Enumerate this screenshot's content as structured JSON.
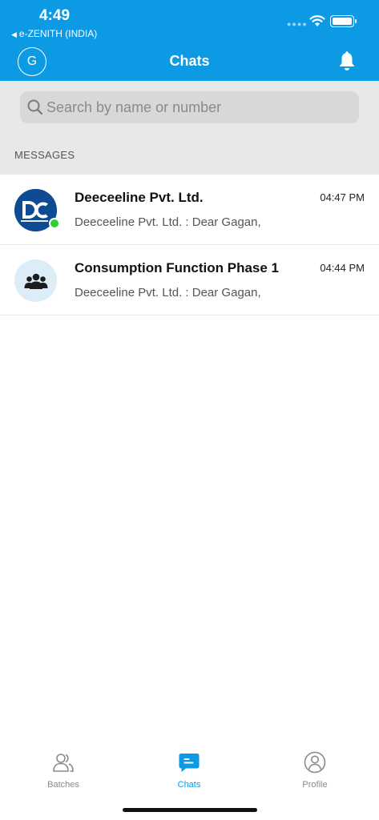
{
  "status_bar": {
    "time": "4:49",
    "back_app": "e-ZENITH (INDIA)",
    "back_icon": "back-triangle-icon"
  },
  "header": {
    "avatar_initial": "G",
    "title": "Chats",
    "bell_icon": "bell-icon"
  },
  "search": {
    "placeholder": "Search by name or number",
    "value": ""
  },
  "section": {
    "label": "MESSAGES"
  },
  "chats": [
    {
      "name": "Deeceeline Pvt. Ltd.",
      "time": "04:47 PM",
      "preview": "Deeceeline Pvt. Ltd. : Dear Gagan,",
      "avatar_text": "DC",
      "online": true
    },
    {
      "name": "Consumption Function Phase 1",
      "time": "04:44 PM",
      "preview": "Deeceeline Pvt. Ltd. : Dear Gagan,",
      "avatar_icon": "group-icon",
      "online": false
    }
  ],
  "tabs": [
    {
      "label": "Batches",
      "icon": "batches-icon",
      "active": false
    },
    {
      "label": "Chats",
      "icon": "chats-icon",
      "active": true
    },
    {
      "label": "Profile",
      "icon": "profile-icon",
      "active": false
    }
  ],
  "colors": {
    "brand": "#0d9ae4",
    "online": "#2fd12f",
    "dc_avatar": "#0e4b93"
  }
}
